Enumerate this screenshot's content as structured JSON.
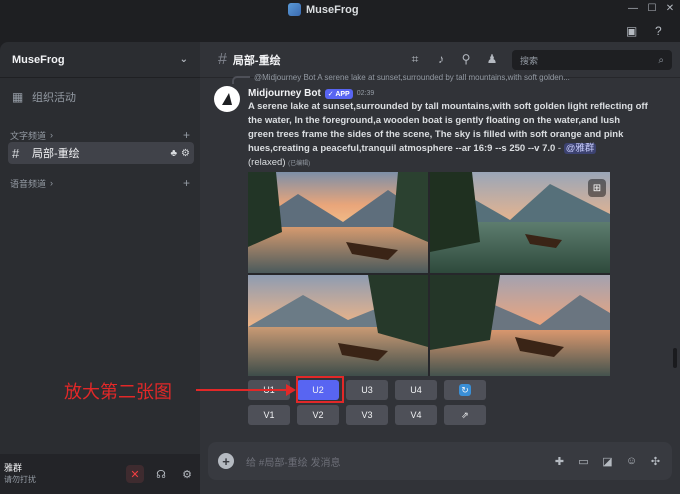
{
  "window": {
    "title": "MuseFrog",
    "controls": {
      "minimize": "—",
      "maximize": "☐",
      "close": "✕"
    }
  },
  "topbar": {
    "inbox_icon": "inbox-icon",
    "help_icon": "help-icon"
  },
  "sidebar": {
    "server_name": "MuseFrog",
    "events_label": "组织活动",
    "text_category": "文字频道",
    "active_channel": "局部-重绘",
    "voice_category": "语音频道"
  },
  "user_panel": {
    "name": "雅群",
    "status": "请勿打扰"
  },
  "channel": {
    "name": "局部-重绘",
    "search_placeholder": "搜索"
  },
  "message": {
    "reply_preview": "@Midjourney Bot A serene lake at sunset,surrounded by tall mountains,with soft golden...",
    "author": "Midjourney Bot",
    "badge": "✓ APP",
    "time": "02:39",
    "prompt": "A serene lake at sunset,surrounded by tall mountains,with soft golden light reflecting off the water, In the foreground,a wooden boat is gently floating on the water,and lush green trees frame the sides of the scene, The sky is filled with soft orange and pink hues,creating a peaceful,tranquil atmosphere --ar 16:9 --s 250 --v 7.0",
    "dash": "-",
    "mention": "@雅群",
    "mode": "(relaxed)",
    "edited": "(已编辑)"
  },
  "buttons": {
    "row1": [
      "U1",
      "U2",
      "U3",
      "U4"
    ],
    "row2": [
      "V1",
      "V2",
      "V3",
      "V4"
    ],
    "refresh_icon": "refresh-icon",
    "open_icon": "external-link-icon"
  },
  "annotation": {
    "text": "放大第二张图",
    "color": "#e22828"
  },
  "composer": {
    "placeholder": "给 #局部-重绘 发消息"
  },
  "colors": {
    "blurple": "#5865f2",
    "sidebar": "#2b2d31",
    "chat": "#313338"
  }
}
